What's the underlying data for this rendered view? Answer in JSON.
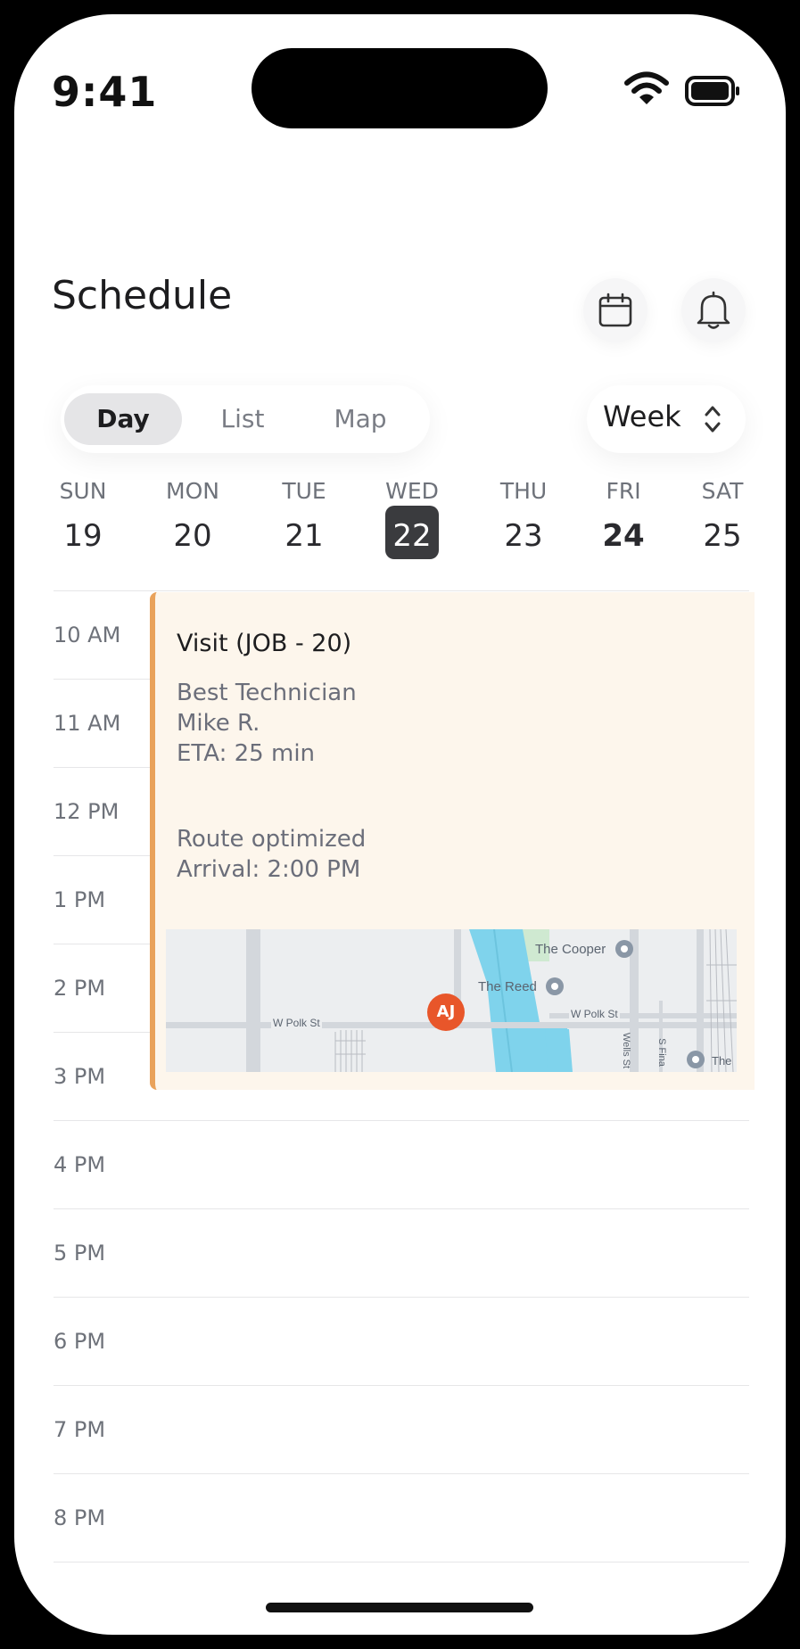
{
  "status_bar": {
    "time": "9:41"
  },
  "header": {
    "title": "Schedule"
  },
  "segmented": {
    "items": [
      "Day",
      "List",
      "Map"
    ],
    "selected": "Day"
  },
  "range_picker": {
    "label": "Week"
  },
  "week": {
    "days": [
      {
        "name": "SUN",
        "num": "19"
      },
      {
        "name": "MON",
        "num": "20"
      },
      {
        "name": "TUE",
        "num": "21"
      },
      {
        "name": "WED",
        "num": "22"
      },
      {
        "name": "THU",
        "num": "23"
      },
      {
        "name": "FRI",
        "num": "24"
      },
      {
        "name": "SAT",
        "num": "25"
      }
    ],
    "selected": "22"
  },
  "timeline": {
    "hours": [
      "10 AM",
      "11 AM",
      "12 PM",
      "1 PM",
      "2 PM",
      "3 PM",
      "4 PM",
      "5 PM",
      "6 PM",
      "7 PM",
      "8 PM"
    ]
  },
  "event": {
    "title": "Visit (JOB - 20)",
    "technician_label": "Best Technician",
    "technician_name": "Mike R.",
    "eta": "ETA: 25 min",
    "route_status": "Route optimized",
    "arrival": "Arrival: 2:00 PM",
    "accent_color": "#e9a25a",
    "background_color": "#fdf6ec"
  },
  "map": {
    "marker_initials": "AJ",
    "marker_color": "#e8562a",
    "labels": {
      "cooper": "The Cooper",
      "reed": "The Reed",
      "polk_left": "W Polk St",
      "polk_right": "W Polk St",
      "wells": "Wells St",
      "financial": "S Fina",
      "partial": "The"
    }
  }
}
